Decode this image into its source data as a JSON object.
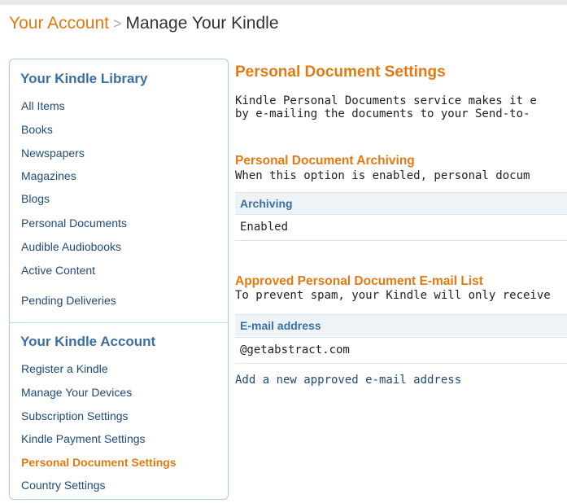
{
  "breadcrumb": {
    "parent": "Your Account",
    "separator": ">",
    "current": "Manage Your Kindle"
  },
  "sidebar": {
    "library_heading": "Your Kindle Library",
    "library_items": [
      "All Items",
      "Books",
      "Newspapers",
      "Magazines",
      "Blogs",
      "Personal Documents",
      "Audible Audiobooks",
      "Active Content",
      "Pending Deliveries"
    ],
    "account_heading": "Your Kindle Account",
    "account_items": [
      "Register a Kindle",
      "Manage Your Devices",
      "Subscription Settings",
      "Kindle Payment Settings",
      "Personal Document Settings",
      "Country Settings"
    ],
    "active_item": "Personal Document Settings"
  },
  "main": {
    "title": "Personal Document Settings",
    "description_line1": "Kindle Personal Documents service makes it e",
    "description_line2": "by e-mailing the documents to your Send-to-",
    "archiving": {
      "title": "Personal Document Archiving",
      "description": "When this option is enabled, personal docum",
      "column_header": "Archiving",
      "value": "Enabled"
    },
    "approved_list": {
      "title": "Approved Personal Document E-mail List",
      "description": "To prevent spam, your Kindle will only receive",
      "column_header": "E-mail address",
      "emails": [
        "@getabstract.com"
      ],
      "add_link": "Add a new approved e-mail address"
    }
  },
  "colors": {
    "accent_orange": "#e47911",
    "link_blue": "#1f4a7a",
    "heading_blue": "#3b6fa3",
    "sidebar_border": "#a8cce0",
    "table_header_bg": "#eef3f8"
  }
}
